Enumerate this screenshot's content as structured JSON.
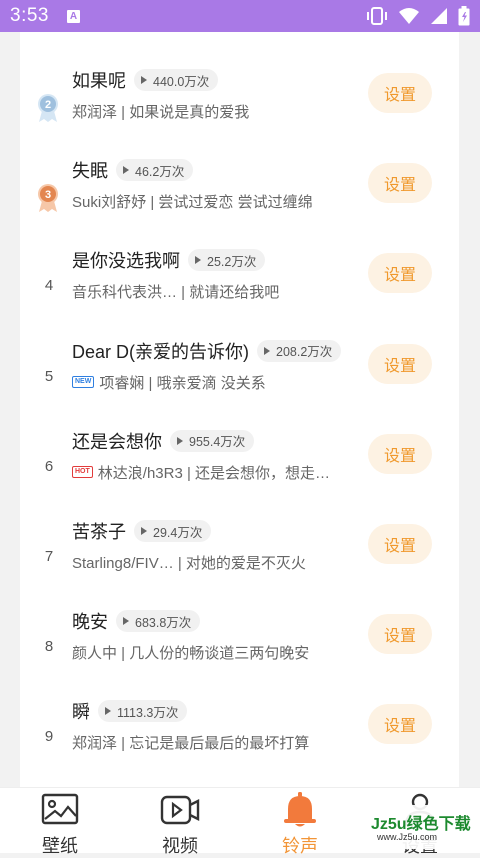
{
  "status_bar": {
    "time": "3:53",
    "notification_letter": "A"
  },
  "list": [
    {
      "rank": "2",
      "medal": "silver",
      "title": "如果呢",
      "plays": "440.0万次",
      "tag": "",
      "subtitle": "郑润泽 | 如果说是真的爱我",
      "button": "设置"
    },
    {
      "rank": "3",
      "medal": "bronze",
      "title": "失眠",
      "plays": "46.2万次",
      "tag": "",
      "subtitle": "Suki刘舒妤 | 尝试过爱恋 尝试过缠绵",
      "button": "设置"
    },
    {
      "rank": "4",
      "medal": "",
      "title": "是你没选我啊",
      "plays": "25.2万次",
      "tag": "",
      "subtitle": "音乐科代表洪… | 就请还给我吧",
      "button": "设置"
    },
    {
      "rank": "5",
      "medal": "",
      "title": "Dear D(亲爱的告诉你)",
      "plays": "208.2万次",
      "tag": "NEW",
      "subtitle": "项睿娴 | 哦亲爱滴 没关系",
      "button": "设置"
    },
    {
      "rank": "6",
      "medal": "",
      "title": "还是会想你",
      "plays": "955.4万次",
      "tag": "HOT",
      "subtitle": "林达浪/h3R3 | 还是会想你，想走…",
      "button": "设置"
    },
    {
      "rank": "7",
      "medal": "",
      "title": "苦茶子",
      "plays": "29.4万次",
      "tag": "",
      "subtitle": "Starling8/FIV… | 对她的爱是不灭火",
      "button": "设置"
    },
    {
      "rank": "8",
      "medal": "",
      "title": "晚安",
      "plays": "683.8万次",
      "tag": "",
      "subtitle": "颜人中 | 几人份的畅谈道三两句晚安",
      "button": "设置"
    },
    {
      "rank": "9",
      "medal": "",
      "title": "瞬",
      "plays": "1113.3万次",
      "tag": "",
      "subtitle": "郑润泽 | 忘记是最后最后的最坏打算",
      "button": "设置"
    }
  ],
  "tabs": [
    {
      "label": "壁纸",
      "icon": "image-icon",
      "active": false
    },
    {
      "label": "视频",
      "icon": "video-icon",
      "active": false
    },
    {
      "label": "铃声",
      "icon": "bell-icon",
      "active": true
    },
    {
      "label": "设置",
      "icon": "person-icon",
      "active": false
    }
  ],
  "watermark": {
    "main": "Jz5u绿色下载",
    "sub": "www.Jz5u.com"
  },
  "colors": {
    "status_bar": "#a979e6",
    "accent": "#f29537",
    "button_bg": "#fdf2e3"
  }
}
